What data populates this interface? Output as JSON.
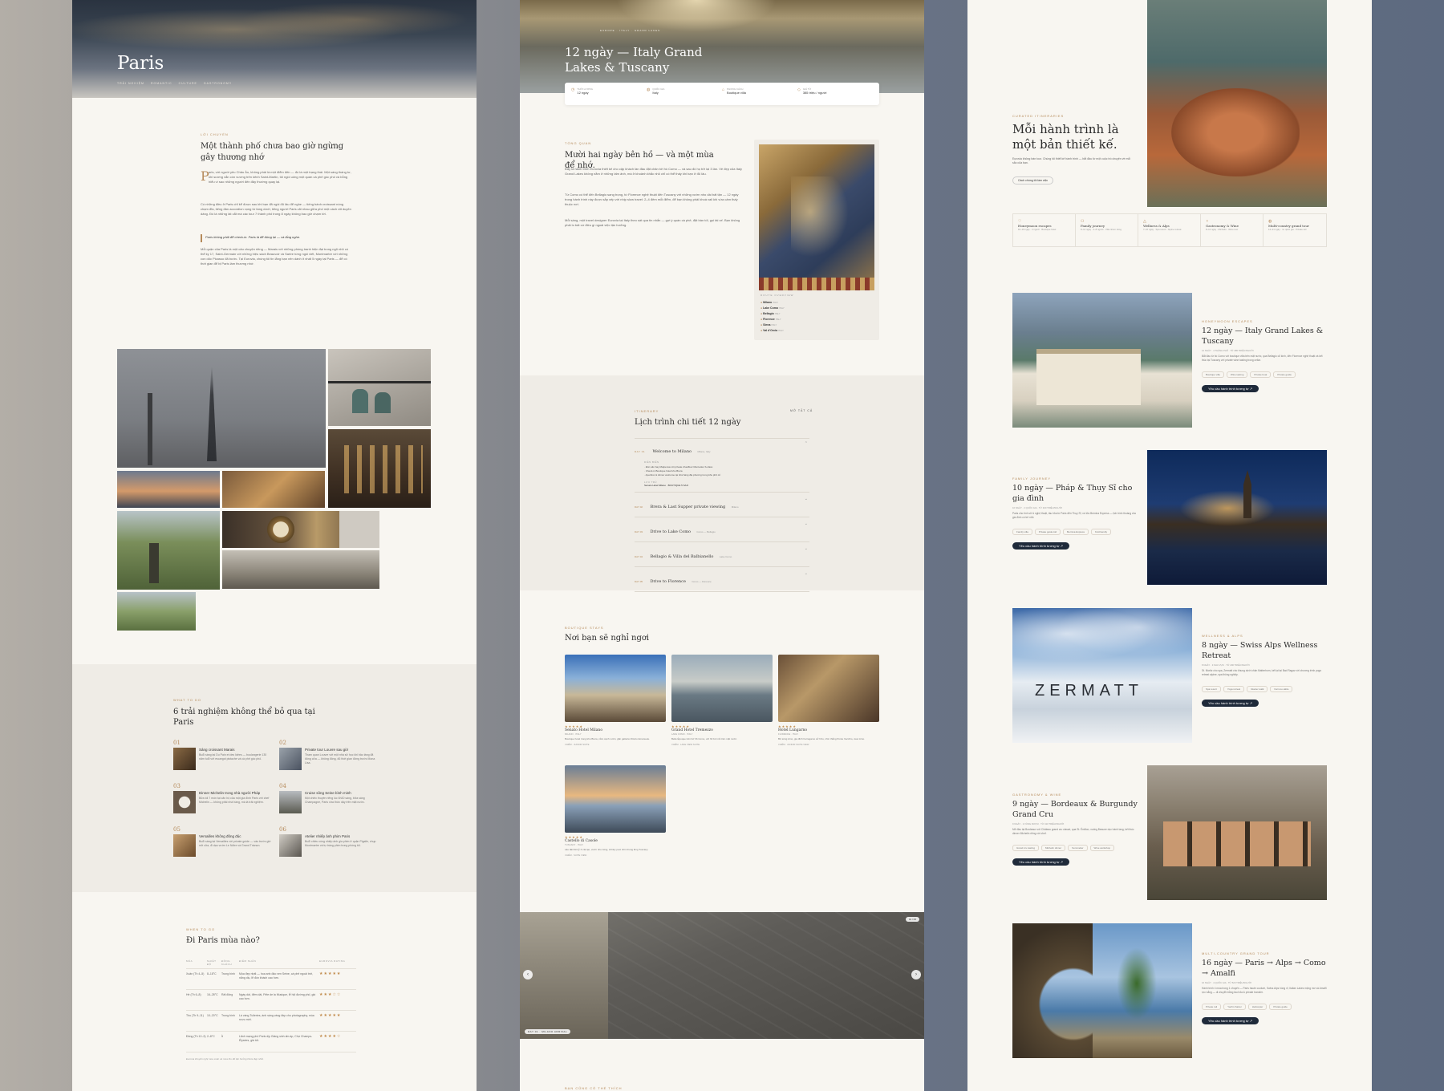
{
  "p1": {
    "hero_title": "Paris",
    "hero_tags": [
      "TRẢI NGHIỆM",
      "ROMANTIC",
      "CULTURE",
      "GASTRONOMY"
    ],
    "intro_eyebrow": "LỜI CHUYỂN",
    "intro_title": "Một thành phố chưa bao giờ ngừng gây thương nhớ",
    "intro_drop": "P",
    "intro_p1": "aris, với người yêu Châu Âu, không phải là một điểm đến — đó là một trạng thái. Một sáng tháng tư, khi sương vẫn còn vương trên kênh Saint-Martin, tôi ngồi uống một quán cà phê góc phố và bỗng hiểu vì sao những người đến đây thường quay lại.",
    "intro_p2": "Có những điều ở Paris chỉ kể được sau khi bạn đã ngồi đủ lâu để nghe — tiếng bánh croissant nóng chạm đĩa, tiếng đàn accordion vọng từ tầng dưới, tiếng người Paris cãi nhau giữa phố một cách rất duyên dáng. Đó là những lát cắt mà các tour 7 thành phố trong 8 ngày không bao giờ chạm tới.",
    "intro_quote": "Paris không phải để check-in. Paris là để đứng lại — và lắng nghe.",
    "intro_p3": "Mỗi quận của Paris là một câu chuyện riêng — Marais với những phòng tranh hiện đại trong ngõ nhỏ có thể kỷ 17, Saint-Germain với những hiệu sách Beauvoir và Sartre từng ngồi viết, Montmartre với những con dốc Picasso đã bước. Tại Eurovia, chúng tôi tin lắng bạn nên dành ít nhất 5 ngày tại Paris — để có thời gian để bị Paris làm thương nhớ.",
    "exp_eyebrow": "WHAT TO DO",
    "exp_title": "6 trải nghiệm không thể bỏ qua tại Paris",
    "experiences": [
      {
        "num": "01",
        "title": "Sáng croissant Marais",
        "text": "Buổi sáng tại Du Pain et des Idées — boulangerie 130 năm tuổi với escargot pistache và cà phê góc phố."
      },
      {
        "num": "02",
        "title": "Private tour Louvre sau giờ",
        "text": "Tham quan Louvre với một nhà sử học khi bảo tàng đã đóng cửa — không đông, đủ thời gian đứng trước Mona Lisa."
      },
      {
        "num": "03",
        "title": "Dinner Michelin trong nhà người Pháp",
        "text": "Bữa tối 7 món tại căn hộ của một gia đình Paris với chef Michelin — không phải nhà hàng, mà là trải nghiệm."
      },
      {
        "num": "04",
        "title": "Cruise sông Seine bình minh",
        "text": "Một chiếc thuyền riêng lúc 6h30 sáng, bữa sáng Champagne, Paris vừa thức dậy trên mặt nước."
      },
      {
        "num": "05",
        "title": "Versailles không đông đúc",
        "text": "Buổi sáng tại Versailles với private guide — vào trước giờ mở cửa, đi dạo vườn Le Nôtre và Grand Trianon."
      },
      {
        "num": "06",
        "title": "Atelier nhiếp ảnh phim Paris",
        "text": "Buổi chiều cùng nhiếp ảnh gia phim ở quận Pigalle, chụp Montmartre và tự tráng phim trong phòng tối."
      }
    ],
    "season_eyebrow": "WHEN TO GO",
    "season_title": "Đi Paris mùa nào?",
    "season_headers": [
      "MÙA",
      "NHIỆT ĐỘ",
      "ĐÔNG KHÁCH",
      "ĐIỂM NHẤN",
      "EUROVIA RATING"
    ],
    "seasons": [
      {
        "season": "Xuân (Th 4–5)",
        "temp": "8–18°C",
        "crowd": "Trung bình",
        "note": "Mùa đẹp nhất — hoa anh đào ven Seine, cà phê ngoài trời, nắng dịu, lễ đón khách cao hơn.",
        "rating": "★★★★★"
      },
      {
        "season": "Hè (Th 6–8)",
        "temp": "16–28°C",
        "crowd": "Rất đông",
        "note": "Ngày dài, đêm dài, Fête de la Musique, lễ hội đường phố, giá cao hơn.",
        "rating": "★★★☆☆"
      },
      {
        "season": "Thu (Th 9–11)",
        "temp": "10–20°C",
        "crowd": "Trung bình",
        "note": "Lá vàng Tuileries, ánh sáng vàng đẹp cho photography, mùa rượu mới.",
        "rating": "★★★★★"
      },
      {
        "season": "Đông (Th 12–3)",
        "temp": "2–8°C",
        "crowd": "Ít",
        "note": "Lãnh mạng phố Paris dịp Giáng sinh ấm áp, Chợ Champs-Élysées, giá tốt.",
        "rating": "★★★★☆"
      }
    ],
    "season_footnote": "Eurovia khuyến nghị mùa xuân và mùa thu để tận hưởng Paris đẹp nhất."
  },
  "p2": {
    "hero_crumb": "EUROPE · ITALY · GRAND LAKES",
    "hero_title": "12 ngày — Italy Grand Lakes & Tuscany",
    "facts": [
      {
        "label": "THỜI LƯỢNG",
        "value": "12 ngày",
        "icon": "clock-icon"
      },
      {
        "label": "QUỐC GIA",
        "value": "Italy",
        "icon": "globe-icon"
      },
      {
        "label": "PHONG CÁCH",
        "value": "Boutique villa",
        "icon": "villa-icon"
      },
      {
        "label": "GIÁ TỪ",
        "value": "385 triệu / người",
        "icon": "tag-icon"
      }
    ],
    "overview_eyebrow": "TỔNG QUAN",
    "overview_title": "Mười hai ngày bên hồ — và một mùa để nhớ.",
    "overview_p1": "Đây là hành trình Eurovia thiết kế cho cặp khách lần đầu đặt chân tới hồ Como — và sau đó họ trở lại 3 lần. Vẻ đẹp của Italy Grand Lakes không nằm ở những tấm ảnh, mà ở khoảnh khắc nhỏ chỉ có thể thấy khi bạn ở đủ lâu.",
    "overview_p2": "Từ Como có thể đến Bellagio sang trọng, từ Florence nghệ thuật đến Tuscany với những vườn nho dài bất tận — 12 ngày trong hành trình này được sắp xếp với nhịp slow travel: 2–4 đêm mỗi điểm, để bạn không phải khoá vali khi vừa cảm thấy thuộc nơi.",
    "overview_p3": "Mỗi sáng, một travel designer Eurovia tại Italy theo sát qua tin nhắn — gợi ý quán cà phê, đặt bàn tối, gọi tài xế. Bạn không phải lo bất cứ điều gì ngoài việc tận hưởng.",
    "route_label": "ROUTE OVERVIEW",
    "route": [
      {
        "city": "Milano",
        "country": "ITALY"
      },
      {
        "city": "Lake Como",
        "country": "ITALY"
      },
      {
        "city": "Bellagio",
        "country": "ITALY"
      },
      {
        "city": "Florence",
        "country": "ITALY"
      },
      {
        "city": "Siena",
        "country": "ITALY"
      },
      {
        "city": "Val d'Orcia",
        "country": "ITALY"
      }
    ],
    "itin_eyebrow": "ITINERARY",
    "itin_expand": "MỞ TẤT CẢ",
    "itin_title": "Lịch trình chi tiết 12 ngày",
    "days": [
      {
        "day": "DAY 01",
        "title": "Welcome to Milano",
        "place": "Milano, Italy"
      },
      {
        "day": "DAY 02",
        "title": "Brera & Last Supper private viewing",
        "place": "Milano"
      },
      {
        "day": "DAY 03",
        "title": "Drive to Lake Como",
        "place": "Como — Bellagio"
      },
      {
        "day": "DAY 04",
        "title": "Bellagio & Villa del Balbianello",
        "place": "Lake Como"
      },
      {
        "day": "DAY 05",
        "title": "Drive to Florence",
        "place": "Como — Florence"
      }
    ],
    "day1_sub_label": "DIỄN BIẾN",
    "day1_items": [
      "Đón sân bay Malpensa với private chauffeur Mercedes S-class",
      "Check-in Boutique hotel khu Brera",
      "Aperitivo & dinner welcome tại nhà hàng địa phương trong khu phố cổ"
    ],
    "day1_hotel_label": "LƯU TRÚ",
    "day1_hotel": "Senato Hotel Milano · BOUTIQUE 5 SAO",
    "stays_eyebrow": "BOUTIQUE STAYS",
    "stays_title": "Nơi bạn sẽ nghỉ ngơi",
    "stays": [
      {
        "name": "Senato Hotel Milano",
        "loc": "MILANO · ITALY",
        "stars": "★★★★★",
        "text": "Boutique hotel trong khu Brera, nằm cạnh vườn, gần galleria Vittorio Emanuele.",
        "nights": "3 ĐÊM · JUNIOR SUITE"
      },
      {
        "name": "Grand Hotel Tremezzo",
        "loc": "LAKE COMO · ITALY",
        "stars": "★★★★★",
        "text": "Belle Époque trên bờ hồ Como, với hồ bơi nổi trên mặt nước.",
        "nights": "3 ĐÊM · LAKE VIEW SUITE"
      },
      {
        "name": "Hotel Lungarno",
        "loc": "FLORENCE · ITALY",
        "stars": "★★★★★",
        "text": "Bờ sông Arno, gia đình Ferragamo sở hữu, nhìn thẳng Ponte Vecchio, view Arno.",
        "nights": "3 ĐÊM · JUNIOR SUITE VIEW"
      },
      {
        "name": "Castello di Casole",
        "loc": "TUSCANY · ITALY",
        "stars": "★★★★★",
        "text": "Lâu đài thế kỷ X cải tạo, vườn nho riêng, infinity pool nhìn thung lũng Tuscany.",
        "nights": "3 ĐÊM · SUITE VIEW"
      }
    ],
    "gallery_counter": "01 / 06",
    "gallery_caption": "DAY 01 · MILANO ARRIVAL",
    "bottom_eyebrow": "BẠN CŨNG CÓ THỂ THÍCH"
  },
  "p3": {
    "hero_eyebrow": "CURATED ITINERARIES",
    "hero_title": "Mỗi hành trình là một bản thiết kế.",
    "hero_text": "Eurovia không bán tour. Chúng tôi thiết kế hành trình — bắt đầu từ một cuộc trò chuyện về mỗi sắc của bạn.",
    "hero_button": "Cách chúng tôi làm việc",
    "categories": [
      {
        "title": "Honeymoon escapes",
        "meta": "10–16 ngày · 2 người · Boutique hotel"
      },
      {
        "title": "Family journey",
        "meta": "8–14 ngày · 4–8 người · Villa nhóm riêng"
      },
      {
        "title": "Wellness & Alps",
        "meta": "7–10 ngày · Spa resort · Alpine retreat"
      },
      {
        "title": "Gastronomy & Wine",
        "meta": "8–12 ngày · Michelin · Wine tour"
      },
      {
        "title": "Multi-country grand tour",
        "meta": "14–21 ngày · 4+ quốc gia · Private rail"
      }
    ],
    "tours": [
      {
        "eyebrow": "HONEYMOON ESCAPES",
        "title": "12 ngày — Italy Grand Lakes & Tuscany",
        "meta": "12 NGÀY · 4 THÀNH PHỐ · TỪ 385 TRIỆU/NGƯỜI",
        "text": "Bắt đầu từ hồ Como với boutique villa bên mặt nước, qua Bellagio cổ kính, đến Florence nghệ thuật và kết thúc tại Tuscany với private wine tasting trong cellar.",
        "chips": [
          "Boutique villa",
          "Wine tasting",
          "Private boat",
          "Private guide"
        ],
        "button": "Yêu cầu hành trình tương tự"
      },
      {
        "eyebrow": "FAMILY JOURNEY",
        "title": "10 ngày — Pháp & Thụy Sĩ cho gia đình",
        "meta": "10 NGÀY · 2 QUỐC GIA · TỪ 320 TRIỆU/NGƯỜI",
        "text": "Paris cho tình sử & nghệ thuật, tàu hỏa từ Paris đến Thụy Sĩ, xe lửa Bernina Express — lịch trình thoáng cho gia đình có trẻ nhỏ.",
        "chips": [
          "Family villa",
          "Private guide kid",
          "Bernina Express",
          "Kid-friendly"
        ],
        "button": "Yêu cầu hành trình tương tự"
      },
      {
        "eyebrow": "WELLNESS & ALPS",
        "title": "8 ngày — Swiss Alps Wellness Retreat",
        "meta": "8 NGÀY · 3 KHU VỰC · TỪ 290 TRIỆU/NGƯỜI",
        "text": "St. Moritz cho spa, Zermatt cho khung dưới chân Matterhorn, kết lại tại Bad Ragaz với chương trình yoga retreat alpine, spa thông nghiệp.",
        "chips": [
          "Spa resort",
          "Yoga retreat",
          "Glacier walk",
          "Farm-to-table"
        ],
        "button": "Yêu cầu hành trình tương tự"
      },
      {
        "eyebrow": "GASTRONOMY & WINE",
        "title": "9 ngày — Bordeaux & Burgundy Grand Cru",
        "meta": "9 NGÀY · 2 VÙNG RƯỢU · TỪ 410 TRIỆU/NGƯỜI",
        "text": "Mở đầu tại Bordeaux với Château grand cru classé, qua St. Émilion, xuống Beaune dọc hành lang, kết thúc dinner Michelin riêng với chef.",
        "chips": [
          "Grand cru tasting",
          "Michelin dinner",
          "Sommelier",
          "Wine workshop"
        ],
        "button": "Yêu cầu hành trình tương tự"
      },
      {
        "eyebrow": "MULTI-COUNTRY GRAND TOUR",
        "title": "16 ngày — Paris → Alps → Como → Amalfi",
        "meta": "16 NGÀY · 4 QUỐC GIA · TỪ 520 TRIỆU/NGƯỜI",
        "text": "Hành trình 4 mùa trong 1 chuyến — Paris haute couture, Swiss Alps hùng vĩ, Italian Lakes mộng mơ và Amalfi rực nắng — di chuyển bằng tàu hỏa & private transfer.",
        "chips": [
          "Private rail",
          "Yacht charter",
          "Helicopter",
          "Private guide"
        ],
        "button": "Yêu cầu hành trình tương tự"
      }
    ],
    "zermatt_sign": "ZERMATT"
  }
}
